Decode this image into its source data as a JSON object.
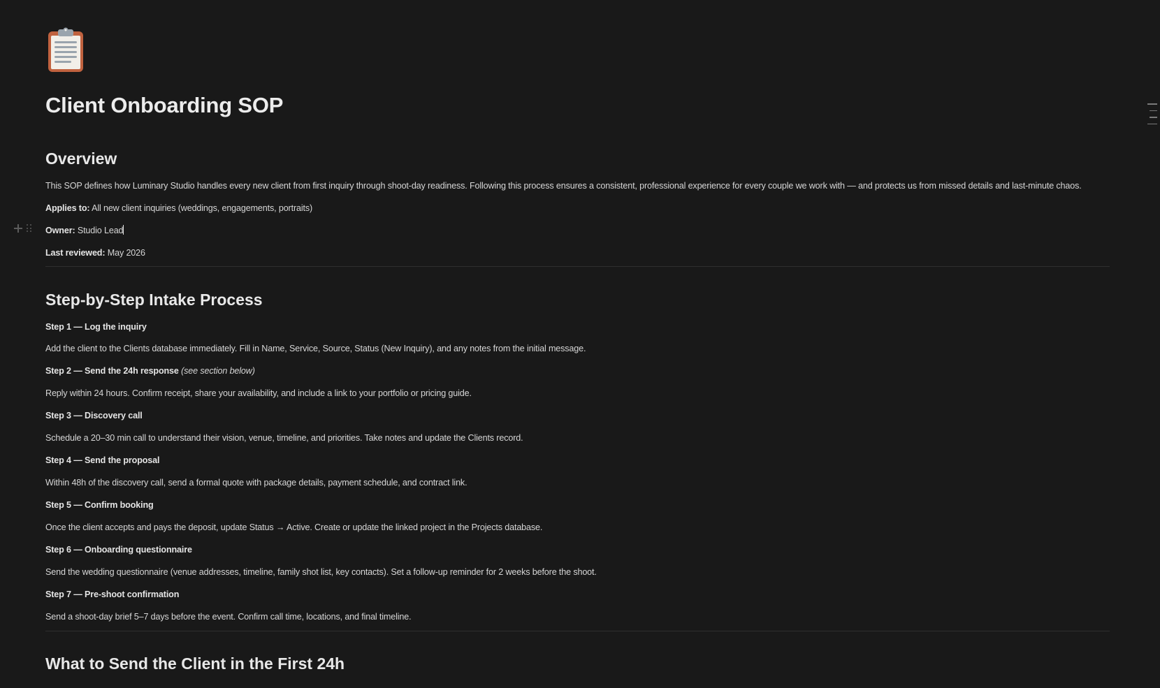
{
  "page": {
    "icon": "clipboard-icon",
    "title": "Client Onboarding SOP"
  },
  "overview": {
    "heading": "Overview",
    "intro": "This SOP defines how Luminary Studio handles every new client from first inquiry through shoot-day readiness. Following this process ensures a consistent, professional experience for every couple we work with — and protects us from missed details and last-minute chaos.",
    "applies_label": "Applies to:",
    "applies_value": " All new client inquiries (weddings, engagements, portraits)",
    "owner_label": "Owner:",
    "owner_value": " Studio Lead",
    "reviewed_label": "Last reviewed:",
    "reviewed_value": " May 2026"
  },
  "intake": {
    "heading": "Step-by-Step Intake Process",
    "steps": [
      {
        "title": "Step 1 — Log the inquiry",
        "note": "",
        "body": "Add the client to the Clients database immediately. Fill in Name, Service, Source, Status (New Inquiry), and any notes from the initial message."
      },
      {
        "title": "Step 2 — Send the 24h response",
        "note": " (see section below)",
        "body": "Reply within 24 hours. Confirm receipt, share your availability, and include a link to your portfolio or pricing guide."
      },
      {
        "title": "Step 3 — Discovery call",
        "note": "",
        "body": "Schedule a 20–30 min call to understand their vision, venue, timeline, and priorities. Take notes and update the Clients record."
      },
      {
        "title": "Step 4 — Send the proposal",
        "note": "",
        "body": "Within 48h of the discovery call, send a formal quote with package details, payment schedule, and contract link."
      },
      {
        "title": "Step 5 — Confirm booking",
        "note": "",
        "body": "Once the client accepts and pays the deposit, update Status → Active. Create or update the linked project in the Projects database."
      },
      {
        "title": "Step 6 — Onboarding questionnaire",
        "note": "",
        "body": "Send the wedding questionnaire (venue addresses, timeline, family shot list, key contacts). Set a follow-up reminder for 2 weeks before the shoot."
      },
      {
        "title": "Step 7 — Pre-shoot confirmation",
        "note": "",
        "body": "Send a shoot-day brief 5–7 days before the event. Confirm call time, locations, and final timeline."
      }
    ]
  },
  "first24h": {
    "heading": "What to Send the Client in the First 24h"
  },
  "colors": {
    "background": "#191919",
    "text": "#d4d4d4",
    "heading": "#e8e8e8",
    "divider": "#2f2f2f",
    "icon_board": "#c0623f",
    "icon_paper": "#f2efe9"
  }
}
